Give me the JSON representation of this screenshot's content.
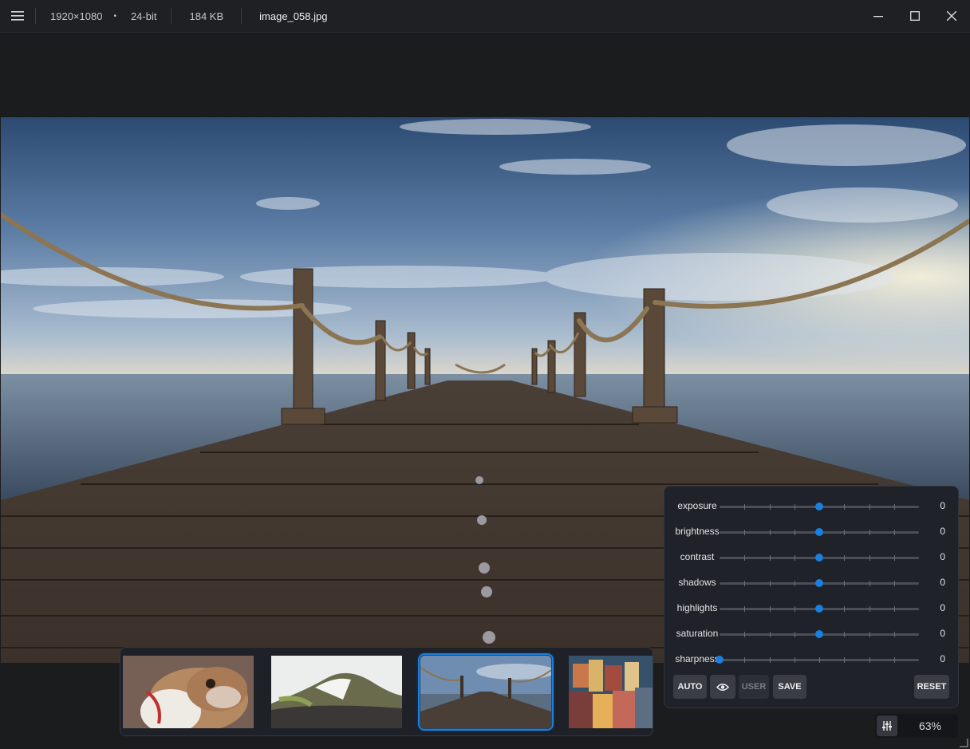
{
  "titlebar": {
    "dimensions": "1920×1080",
    "separator": "•",
    "bit_depth": "24-bit",
    "file_size": "184 KB",
    "filename": "image_058.jpg"
  },
  "adjustments": {
    "items": [
      {
        "label": "exposure",
        "value": "0",
        "level": 0.5
      },
      {
        "label": "brightness",
        "value": "0",
        "level": 0.5
      },
      {
        "label": "contrast",
        "value": "0",
        "level": 0.5
      },
      {
        "label": "shadows",
        "value": "0",
        "level": 0.5
      },
      {
        "label": "highlights",
        "value": "0",
        "level": 0.5
      },
      {
        "label": "saturation",
        "value": "0",
        "level": 0.5
      },
      {
        "label": "sharpness",
        "value": "0",
        "level": 0.0
      }
    ],
    "buttons": {
      "auto": "AUTO",
      "user": "USER",
      "save": "SAVE",
      "reset": "RESET"
    }
  },
  "zoom": {
    "value": "63%"
  },
  "colors": {
    "accent": "#1a7fe0",
    "background": "#1b1c1e"
  }
}
